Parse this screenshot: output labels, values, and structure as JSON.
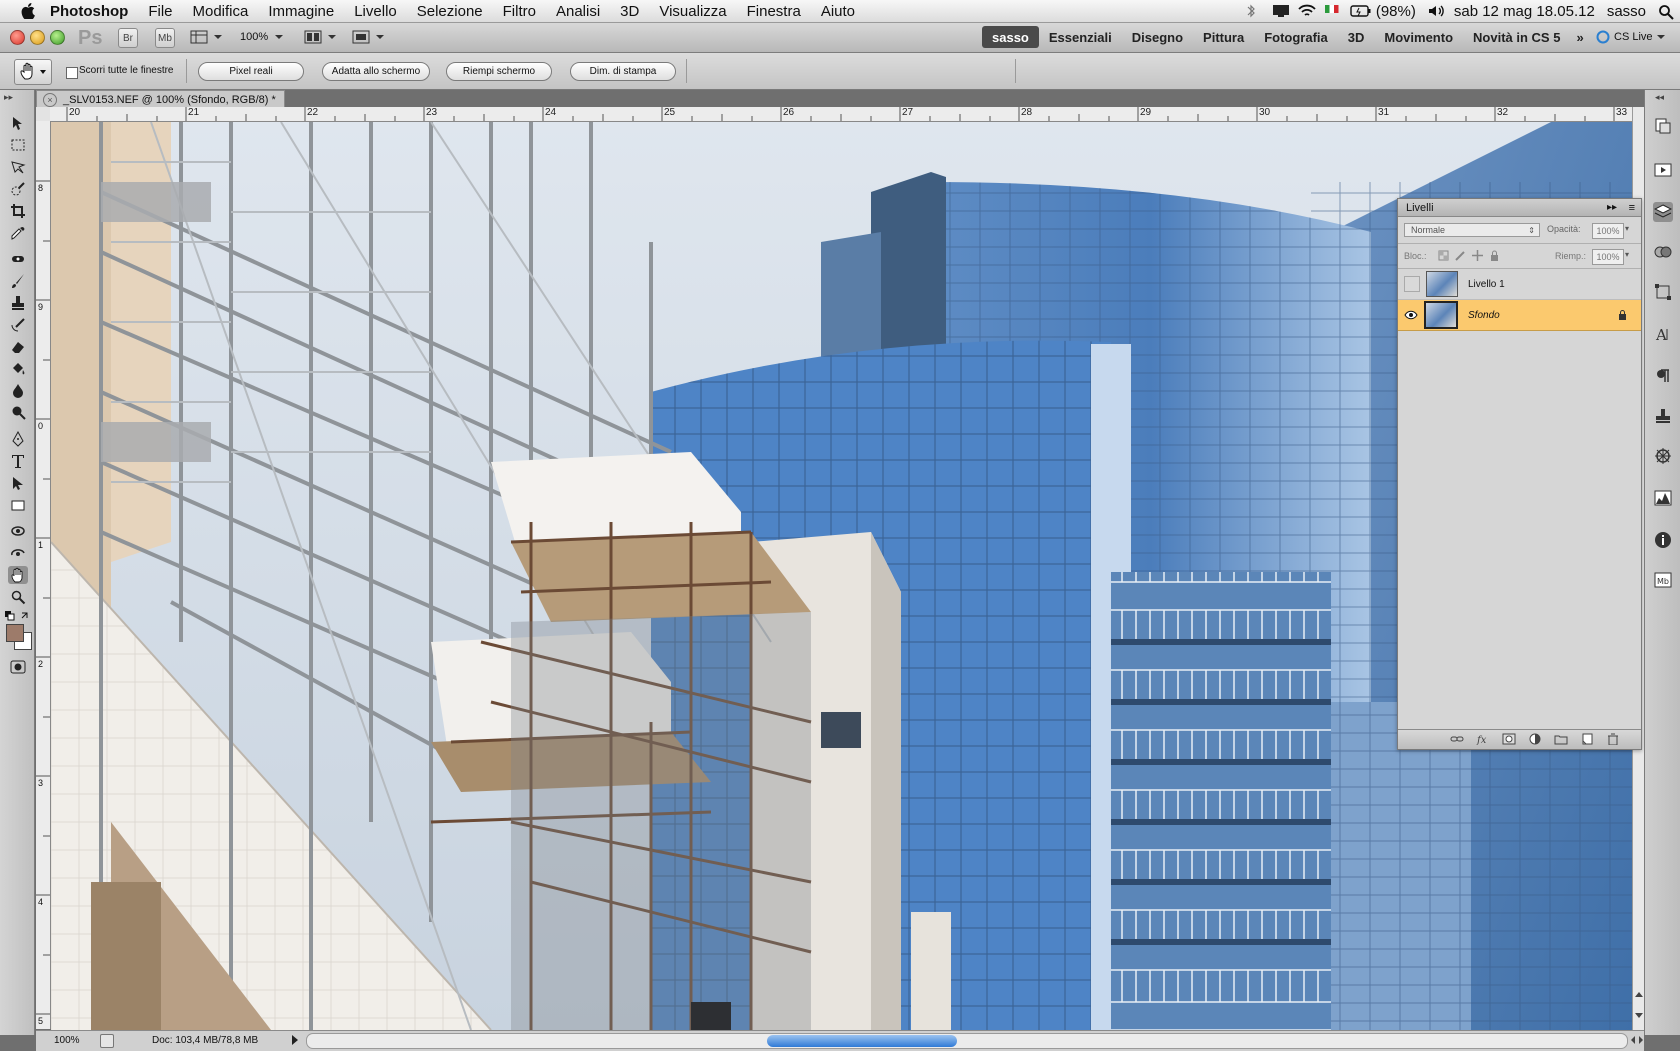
{
  "menubar": {
    "app_name": "Photoshop",
    "items": [
      "File",
      "Modifica",
      "Immagine",
      "Livello",
      "Selezione",
      "Filtro",
      "Analisi",
      "3D",
      "Visualizza",
      "Finestra",
      "Aiuto"
    ],
    "battery": "(98%)",
    "datetime": "sab 12 mag  18.05.12",
    "user": "sasso"
  },
  "appbar": {
    "logo": "Ps",
    "bridge": "Br",
    "minibridge": "Mb",
    "zoom": "100%",
    "workspaces": [
      "sasso",
      "Essenziali",
      "Disegno",
      "Pittura",
      "Fotografia",
      "3D",
      "Movimento",
      "Novità in CS 5"
    ],
    "more": "»",
    "cslive": "CS Live"
  },
  "optionsbar": {
    "scroll_all_label": "Scorri tutte le finestre",
    "buttons": [
      "Pixel reali",
      "Adatta allo schermo",
      "Riempi schermo",
      "Dim. di stampa"
    ]
  },
  "document": {
    "tab_title": "_SLV0153.NEF @ 100% (Sfondo, RGB/8) *"
  },
  "ruler": {
    "top_labels": [
      "20",
      "21",
      "22",
      "23",
      "24",
      "25",
      "26",
      "27",
      "28",
      "29",
      "30",
      "31",
      "32",
      "33"
    ],
    "left_labels": [
      "8",
      "9",
      "0",
      "1",
      "2",
      "3",
      "4",
      "5"
    ]
  },
  "layers_panel": {
    "title": "Livelli",
    "blend_mode": "Normale",
    "opacity_label": "Opacità:",
    "opacity_value": "100%",
    "lock_label": "Bloc.:",
    "fill_label": "Riemp.:",
    "fill_value": "100%",
    "layers": [
      {
        "name": "Livello 1",
        "visible": false,
        "selected": false,
        "locked": false
      },
      {
        "name": "Sfondo",
        "visible": true,
        "selected": true,
        "locked": true
      }
    ]
  },
  "statusbar": {
    "zoom": "100%",
    "doc_info": "Doc: 103,4 MB/78,8 MB"
  },
  "colors": {
    "accent_selected_layer": "#fbc96e",
    "sky": "#cfdbe8",
    "glass": "#4f7fb8"
  }
}
